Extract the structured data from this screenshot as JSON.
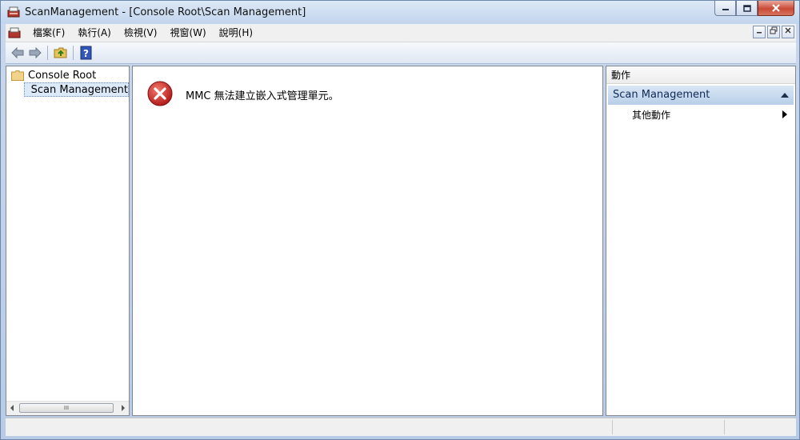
{
  "window": {
    "title": "ScanManagement - [Console Root\\Scan Management]"
  },
  "menu": {
    "items": [
      "檔案(F)",
      "執行(A)",
      "檢視(V)",
      "視窗(W)",
      "說明(H)"
    ]
  },
  "toolbar": {
    "buttons": [
      "back-arrow-icon",
      "forward-arrow-icon",
      "up-folder-icon",
      "help-icon"
    ]
  },
  "tree": {
    "root": "Console Root",
    "child": "Scan Management",
    "scroll_grip": "III"
  },
  "content": {
    "error_message": "MMC 無法建立嵌入式管理單元。"
  },
  "actions": {
    "header": "動作",
    "section": "Scan Management",
    "item": "其他動作"
  },
  "colors": {
    "accent": "#b8cfe9",
    "error": "#c42b2b"
  }
}
